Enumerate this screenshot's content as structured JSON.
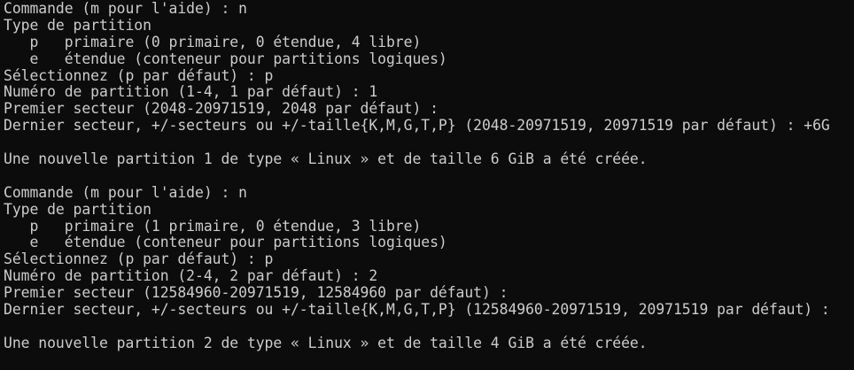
{
  "terminal": {
    "lines": [
      "Commande (m pour l'aide) : n",
      "Type de partition",
      "   p   primaire (0 primaire, 0 étendue, 4 libre)",
      "   e   étendue (conteneur pour partitions logiques)",
      "Sélectionnez (p par défaut) : p",
      "Numéro de partition (1-4, 1 par défaut) : 1",
      "Premier secteur (2048-20971519, 2048 par défaut) :",
      "Dernier secteur, +/-secteurs ou +/-taille{K,M,G,T,P} (2048-20971519, 20971519 par défaut) : +6G",
      "",
      "Une nouvelle partition 1 de type « Linux » et de taille 6 GiB a été créée.",
      "",
      "Commande (m pour l'aide) : n",
      "Type de partition",
      "   p   primaire (1 primaire, 0 étendue, 3 libre)",
      "   e   étendue (conteneur pour partitions logiques)",
      "Sélectionnez (p par défaut) : p",
      "Numéro de partition (2-4, 2 par défaut) : 2",
      "Premier secteur (12584960-20971519, 12584960 par défaut) :",
      "Dernier secteur, +/-secteurs ou +/-taille{K,M,G,T,P} (12584960-20971519, 20971519 par défaut) :",
      "",
      "Une nouvelle partition 2 de type « Linux » et de taille 4 GiB a été créée."
    ]
  }
}
